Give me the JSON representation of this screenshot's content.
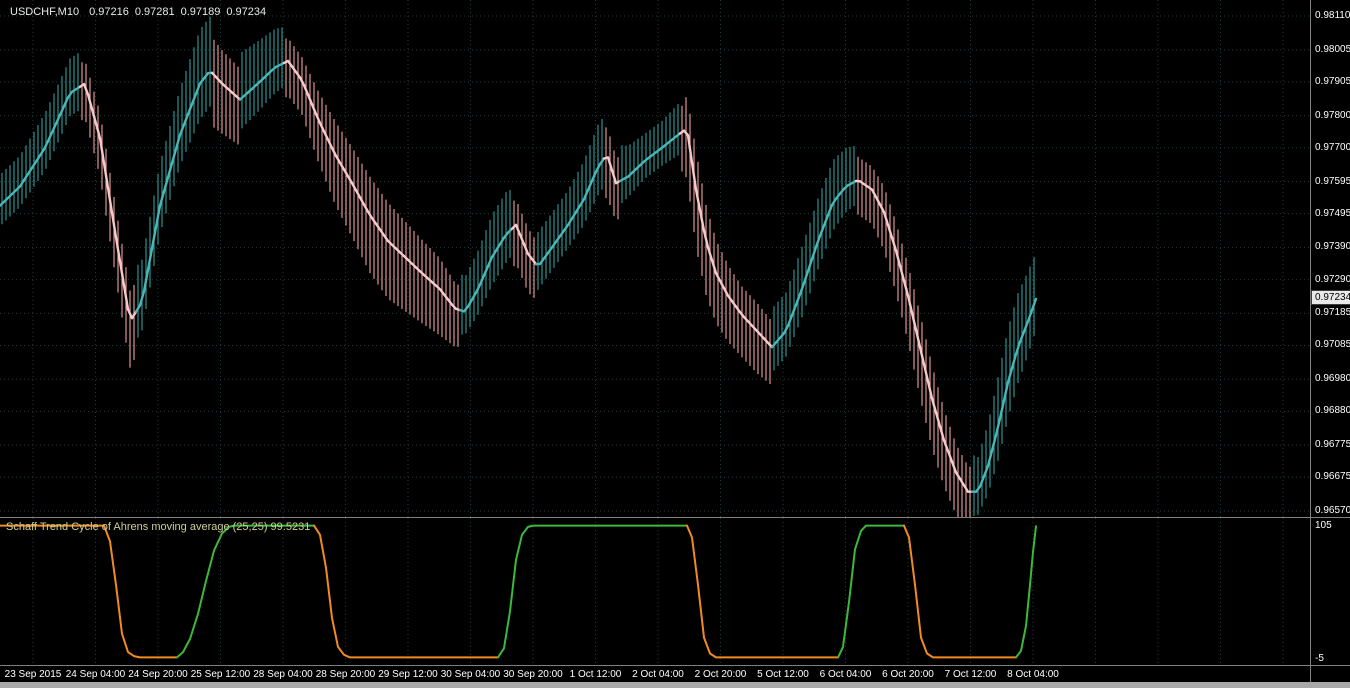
{
  "header": {
    "symbol_timeframe": "USDCHF,M10",
    "open": "0.97216",
    "high": "0.97281",
    "low": "0.97189",
    "close": "0.97234"
  },
  "price_scale": {
    "current_price": "0.97234"
  },
  "indicator_panel": {
    "label": "Schaff Trend Cycle of Ahrens moving average (25,25) 99.5231",
    "scale_max": "105",
    "scale_min": "-5"
  },
  "colors": {
    "background": "#000000",
    "grid": "#1e3c3c",
    "bar_up": "#2f9e9e",
    "bar_down": "#f2a2a2",
    "ma_up": "#4cb6b6",
    "ma_down": "#f6caca",
    "stc_up": "#3cb83c",
    "stc_down": "#f18a21",
    "scale_text": "#ffffff",
    "separator": "#7f7f7f"
  },
  "chart_data": [
    {
      "type": "bar",
      "subtype": "ohlc-bars-with-moving-average",
      "title": "USDCHF,M10",
      "ohlc": {
        "open": 0.97216,
        "high": 0.97281,
        "low": 0.97189,
        "close": 0.97234
      },
      "last_price": 0.97234,
      "ylim": [
        0.9657,
        0.9811
      ],
      "y_ticks": [
        0.9811,
        0.98005,
        0.97905,
        0.978,
        0.977,
        0.97595,
        0.97495,
        0.9739,
        0.9729,
        0.97185,
        0.97085,
        0.9698,
        0.9688,
        0.96775,
        0.96675,
        0.9657
      ],
      "x_ticks": [
        "23 Sep 2015",
        "24 Sep 04:00",
        "24 Sep 20:00",
        "25 Sep 12:00",
        "28 Sep 04:00",
        "28 Sep 20:00",
        "29 Sep 12:00",
        "30 Sep 04:00",
        "30 Sep 20:00",
        "1 Oct 12:00",
        "2 Oct 04:00",
        "2 Oct 20:00",
        "5 Oct 12:00",
        "6 Oct 04:00",
        "6 Oct 20:00",
        "7 Oct 12:00",
        "8 Oct 04:00"
      ],
      "x_start": 33,
      "x_step": 62.5,
      "grid": true,
      "ma_keypoints": [
        [
          0,
          0.9752,
          0.0016
        ],
        [
          20,
          0.9758,
          0.0016
        ],
        [
          45,
          0.977,
          0.0018
        ],
        [
          70,
          0.9787,
          0.0018
        ],
        [
          85,
          0.979,
          0.0018
        ],
        [
          100,
          0.9773,
          0.002
        ],
        [
          115,
          0.9744,
          0.0022
        ],
        [
          130,
          0.9716,
          0.0024
        ],
        [
          142,
          0.9722,
          0.0022
        ],
        [
          160,
          0.9752,
          0.0022
        ],
        [
          180,
          0.9774,
          0.0024
        ],
        [
          200,
          0.979,
          0.0028
        ],
        [
          210,
          0.9794,
          0.0028
        ],
        [
          222,
          0.979,
          0.0026
        ],
        [
          240,
          0.9785,
          0.0024
        ],
        [
          258,
          0.979,
          0.0022
        ],
        [
          275,
          0.9795,
          0.002
        ],
        [
          288,
          0.9797,
          0.0018
        ],
        [
          302,
          0.9791,
          0.0018
        ],
        [
          318,
          0.9779,
          0.0022
        ],
        [
          335,
          0.9768,
          0.0026
        ],
        [
          352,
          0.9759,
          0.0028
        ],
        [
          370,
          0.9749,
          0.003
        ],
        [
          388,
          0.9741,
          0.003
        ],
        [
          405,
          0.9736,
          0.0028
        ],
        [
          422,
          0.9731,
          0.0026
        ],
        [
          440,
          0.9726,
          0.0024
        ],
        [
          455,
          0.972,
          0.002
        ],
        [
          465,
          0.9719,
          0.0018
        ],
        [
          478,
          0.9726,
          0.002
        ],
        [
          492,
          0.9736,
          0.0022
        ],
        [
          506,
          0.9743,
          0.0022
        ],
        [
          516,
          0.9746,
          0.002
        ],
        [
          528,
          0.9737,
          0.002
        ],
        [
          538,
          0.9733,
          0.0018
        ],
        [
          552,
          0.9739,
          0.0018
        ],
        [
          568,
          0.9746,
          0.0018
        ],
        [
          584,
          0.9754,
          0.002
        ],
        [
          598,
          0.9764,
          0.0022
        ],
        [
          607,
          0.9768,
          0.0022
        ],
        [
          616,
          0.9759,
          0.002
        ],
        [
          628,
          0.9761,
          0.0016
        ],
        [
          645,
          0.9766,
          0.0014
        ],
        [
          662,
          0.977,
          0.0014
        ],
        [
          678,
          0.9774,
          0.0016
        ],
        [
          687,
          0.9776,
          0.0026
        ],
        [
          696,
          0.9757,
          0.003
        ],
        [
          706,
          0.9741,
          0.0028
        ],
        [
          716,
          0.9731,
          0.0026
        ],
        [
          728,
          0.9724,
          0.0024
        ],
        [
          742,
          0.9718,
          0.0022
        ],
        [
          757,
          0.9713,
          0.0022
        ],
        [
          772,
          0.9708,
          0.002
        ],
        [
          786,
          0.9713,
          0.002
        ],
        [
          802,
          0.9726,
          0.0022
        ],
        [
          818,
          0.9741,
          0.0022
        ],
        [
          833,
          0.9753,
          0.0022
        ],
        [
          846,
          0.9758,
          0.002
        ],
        [
          858,
          0.976,
          0.0018
        ],
        [
          872,
          0.9757,
          0.0018
        ],
        [
          884,
          0.975,
          0.002
        ],
        [
          896,
          0.9738,
          0.0022
        ],
        [
          908,
          0.9724,
          0.0024
        ],
        [
          920,
          0.9708,
          0.0026
        ],
        [
          932,
          0.9692,
          0.0026
        ],
        [
          944,
          0.9679,
          0.0024
        ],
        [
          956,
          0.9669,
          0.0022
        ],
        [
          968,
          0.9663,
          0.002
        ],
        [
          978,
          0.9663,
          0.0018
        ],
        [
          988,
          0.9671,
          0.0022
        ],
        [
          998,
          0.9683,
          0.0026
        ],
        [
          1008,
          0.9697,
          0.0028
        ],
        [
          1018,
          0.9708,
          0.0028
        ],
        [
          1028,
          0.9716,
          0.0026
        ],
        [
          1036,
          0.9723,
          0.0024
        ]
      ]
    },
    {
      "type": "line",
      "name": "Schaff Trend Cycle of Ahrens moving average (25,25)",
      "current_value": 99.5231,
      "ylim": [
        -5,
        105
      ],
      "level_labels": [
        "105",
        "-5"
      ],
      "segments": [
        {
          "dir": "down",
          "points": [
            [
              0,
              100
            ],
            [
              104,
              100
            ],
            [
              110,
              88
            ],
            [
              116,
              55
            ],
            [
              122,
              18
            ],
            [
              128,
              4
            ],
            [
              134,
              1
            ],
            [
              140,
              0
            ],
            [
              177,
              0
            ]
          ]
        },
        {
          "dir": "up",
          "points": [
            [
              177,
              0
            ],
            [
              183,
              4
            ],
            [
              190,
              14
            ],
            [
              198,
              33
            ],
            [
              206,
              58
            ],
            [
              214,
              81
            ],
            [
              222,
              94
            ],
            [
              229,
              99
            ],
            [
              234,
              100
            ],
            [
              314,
              100
            ]
          ]
        },
        {
          "dir": "down",
          "points": [
            [
              314,
              100
            ],
            [
              320,
              93
            ],
            [
              326,
              68
            ],
            [
              332,
              30
            ],
            [
              338,
              8
            ],
            [
              344,
              2
            ],
            [
              350,
              0
            ],
            [
              498,
              0
            ]
          ]
        },
        {
          "dir": "up",
          "points": [
            [
              498,
              0
            ],
            [
              504,
              7
            ],
            [
              510,
              35
            ],
            [
              516,
              74
            ],
            [
              522,
              93
            ],
            [
              528,
              99
            ],
            [
              533,
              100
            ],
            [
              687,
              100
            ]
          ]
        },
        {
          "dir": "down",
          "points": [
            [
              687,
              100
            ],
            [
              692,
              91
            ],
            [
              698,
              55
            ],
            [
              704,
              15
            ],
            [
              710,
              3
            ],
            [
              716,
              0
            ],
            [
              838,
              0
            ]
          ]
        },
        {
          "dir": "up",
          "points": [
            [
              838,
              0
            ],
            [
              843,
              8
            ],
            [
              849,
              42
            ],
            [
              855,
              82
            ],
            [
              861,
              96
            ],
            [
              866,
              100
            ],
            [
              904,
              100
            ]
          ]
        },
        {
          "dir": "down",
          "points": [
            [
              904,
              100
            ],
            [
              909,
              91
            ],
            [
              915,
              55
            ],
            [
              921,
              15
            ],
            [
              927,
              3
            ],
            [
              933,
              0
            ],
            [
              1016,
              0
            ]
          ]
        },
        {
          "dir": "up",
          "points": [
            [
              1016,
              0
            ],
            [
              1021,
              5
            ],
            [
              1026,
              24
            ],
            [
              1030,
              55
            ],
            [
              1033,
              80
            ],
            [
              1036,
              99.5
            ]
          ]
        }
      ]
    }
  ]
}
